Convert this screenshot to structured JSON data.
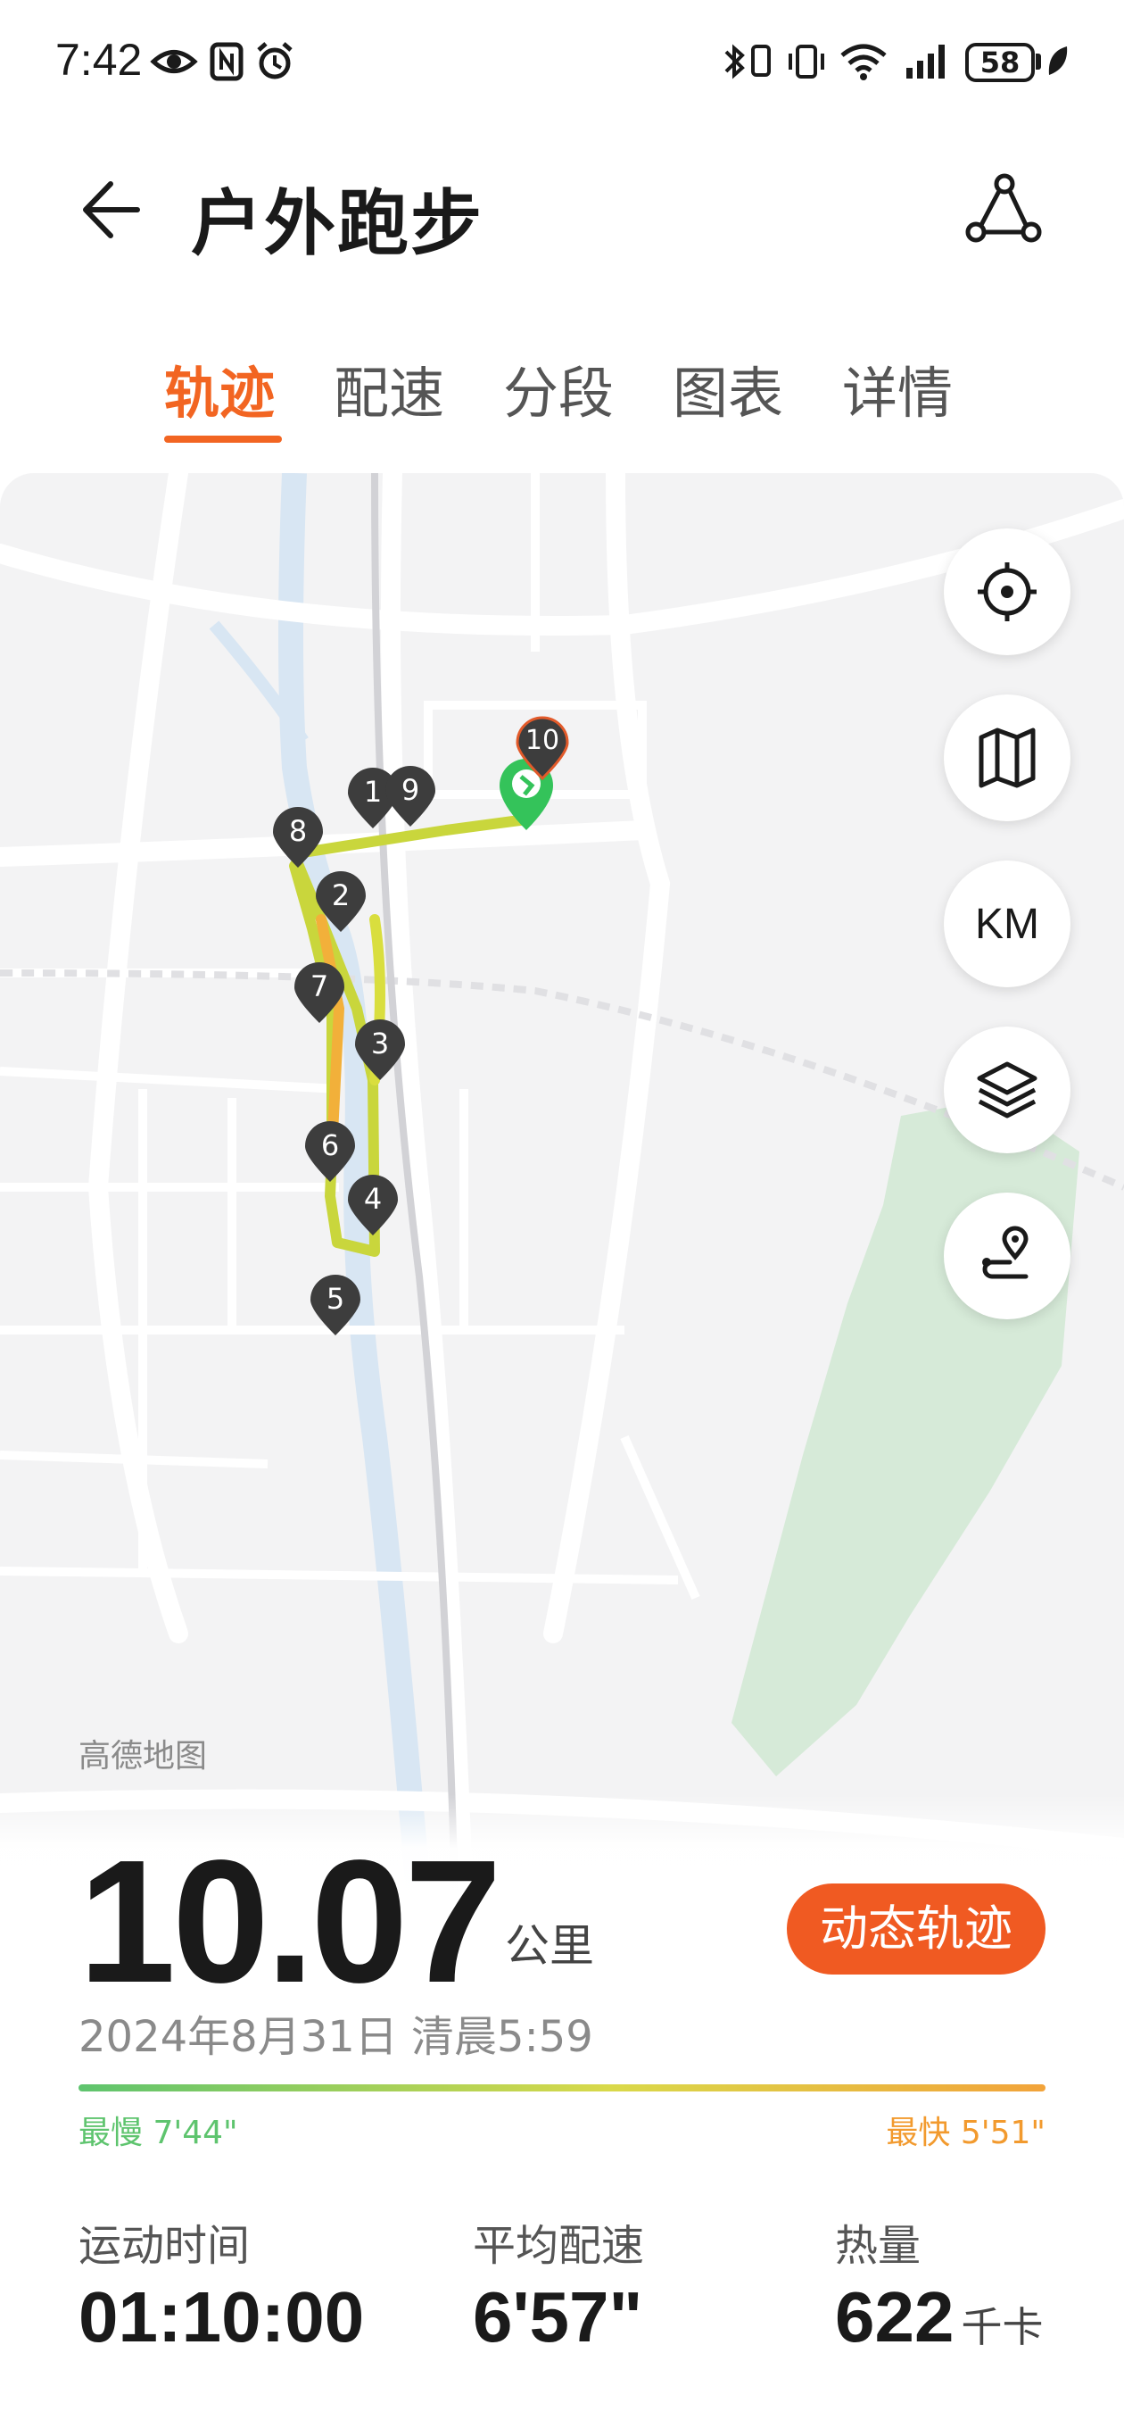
{
  "status_bar": {
    "time": "7:42",
    "battery": "58",
    "icons": [
      "eye-icon",
      "nfc-icon",
      "alarm-icon",
      "bluetooth-icon",
      "vibrate-icon",
      "wifi-icon",
      "signal-icon",
      "battery-icon",
      "leaf-icon"
    ]
  },
  "header": {
    "title": "户外跑步",
    "back_icon": "back-arrow-icon",
    "share_icon": "share-route-icon"
  },
  "tabs": [
    {
      "label": "轨迹",
      "active": true
    },
    {
      "label": "配速",
      "active": false
    },
    {
      "label": "分段",
      "active": false
    },
    {
      "label": "图表",
      "active": false
    },
    {
      "label": "详情",
      "active": false
    }
  ],
  "map": {
    "attribution": "高德地图",
    "markers": [
      "1",
      "2",
      "3",
      "4",
      "5",
      "6",
      "7",
      "8",
      "9",
      "10"
    ],
    "buttons": {
      "locate_icon": "locate-icon",
      "map_icon": "map-icon",
      "unit_label": "KM",
      "layers_icon": "layers-icon",
      "route_icon": "route-pin-icon"
    }
  },
  "summary": {
    "distance": "10.07",
    "distance_unit": "公里",
    "replay_button": "动态轨迹",
    "datetime": "2024年8月31日 清晨5:59",
    "slowest": "最慢 7'44\"",
    "fastest": "最快 5'51\"",
    "colors": {
      "accent": "#f26522",
      "slow": "#5ec46e",
      "fast": "#f29a2e"
    }
  },
  "metrics": [
    {
      "label": "运动时间",
      "value": "01:10:00",
      "unit": ""
    },
    {
      "label": "平均配速",
      "value": "6'57\"",
      "unit": ""
    },
    {
      "label": "热量",
      "value": "622",
      "unit": "千卡"
    }
  ]
}
